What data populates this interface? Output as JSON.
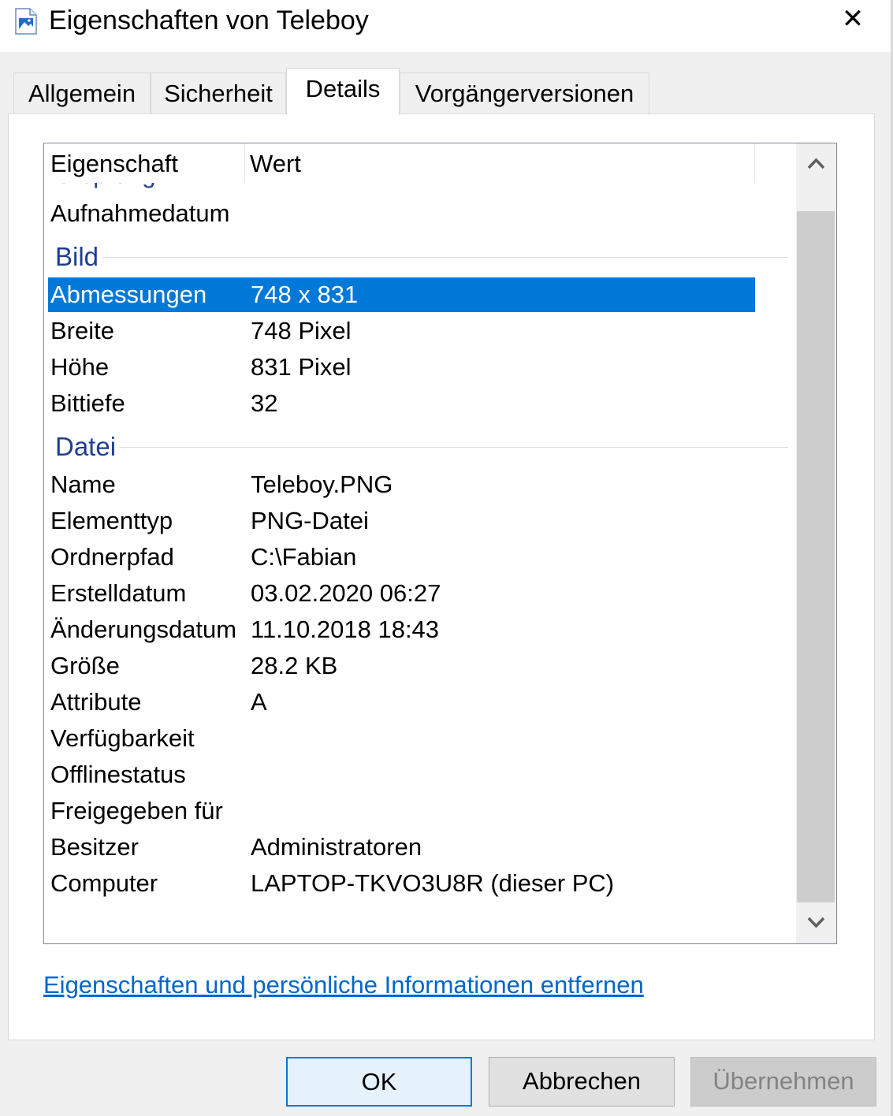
{
  "window": {
    "title": "Eigenschaften von Teleboy",
    "close_glyph": "✕"
  },
  "tabs": [
    {
      "label": "Allgemein"
    },
    {
      "label": "Sicherheit"
    },
    {
      "label": "Details",
      "active": true
    },
    {
      "label": "Vorgängerversionen"
    }
  ],
  "details": {
    "columns": {
      "property": "Eigenschaft",
      "value": "Wert"
    },
    "partial_group": "Ursprung",
    "top_rows": [
      {
        "key": "Aufnahmedatum",
        "value": ""
      }
    ],
    "groups": [
      {
        "label": "Bild",
        "rows": [
          {
            "key": "Abmessungen",
            "value": "748 x 831",
            "selected": true
          },
          {
            "key": "Breite",
            "value": "748 Pixel"
          },
          {
            "key": "Höhe",
            "value": "831 Pixel"
          },
          {
            "key": "Bittiefe",
            "value": "32"
          }
        ]
      },
      {
        "label": "Datei",
        "rows": [
          {
            "key": "Name",
            "value": "Teleboy.PNG"
          },
          {
            "key": "Elementtyp",
            "value": "PNG-Datei"
          },
          {
            "key": "Ordnerpfad",
            "value": "C:\\Fabian"
          },
          {
            "key": "Erstelldatum",
            "value": "03.02.2020 06:27"
          },
          {
            "key": "Änderungsdatum",
            "value": "11.10.2018 18:43"
          },
          {
            "key": "Größe",
            "value": "28.2 KB"
          },
          {
            "key": "Attribute",
            "value": "A"
          },
          {
            "key": "Verfügbarkeit",
            "value": ""
          },
          {
            "key": "Offlinestatus",
            "value": ""
          },
          {
            "key": "Freigegeben für",
            "value": ""
          },
          {
            "key": "Besitzer",
            "value": "Administratoren"
          },
          {
            "key": "Computer",
            "value": "LAPTOP-TKVO3U8R (dieser PC)"
          }
        ]
      }
    ]
  },
  "remove_link": "Eigenschaften und persönliche Informationen entfernen",
  "buttons": {
    "ok": "OK",
    "cancel": "Abbrechen",
    "apply": "Übernehmen"
  },
  "colors": {
    "selection": "#0078d7",
    "group_header": "#1e3f8f",
    "link": "#0066cc"
  },
  "icons": {
    "title": "image-file-icon",
    "close": "close-icon",
    "scroll_up": "chevron-up-icon",
    "scroll_down": "chevron-down-icon"
  }
}
